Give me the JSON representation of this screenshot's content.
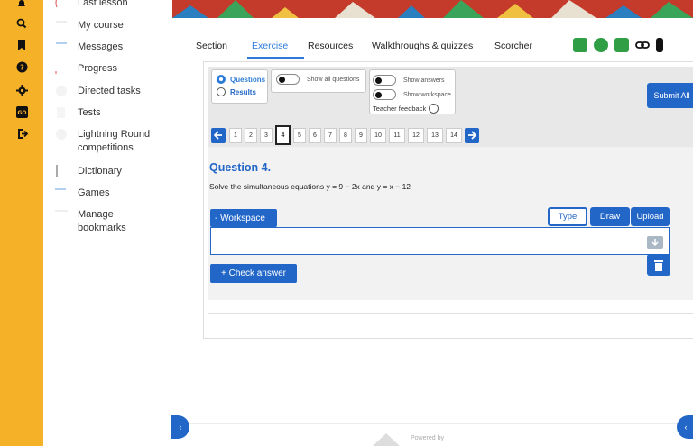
{
  "rail": {
    "icons": [
      "bell-icon",
      "search-icon",
      "bookmark-icon",
      "help-icon",
      "settings-icon",
      "go-icon",
      "logout-icon"
    ],
    "go_label": "GO",
    "color": "#f5b228"
  },
  "sidebar": {
    "items": [
      {
        "label": "Last lesson",
        "icon": "last-lesson-icon"
      },
      {
        "label": "My course",
        "icon": "course-icon"
      },
      {
        "label": "Messages",
        "icon": "messages-icon"
      },
      {
        "label": "Progress",
        "icon": "progress-icon"
      },
      {
        "label": "Directed tasks",
        "icon": "directed-tasks-icon"
      },
      {
        "label": "Tests",
        "icon": "tests-icon"
      },
      {
        "label": "Lightning Round competitions",
        "icon": "lightning-icon"
      },
      {
        "label": "Dictionary",
        "icon": "dictionary-icon"
      },
      {
        "label": "Games",
        "icon": "games-icon"
      },
      {
        "label": "Manage bookmarks",
        "icon": "bookmarks-icon"
      }
    ]
  },
  "tabs": {
    "items": [
      "Section",
      "Exercise",
      "Resources",
      "Walkthroughs & quizzes",
      "Scorcher"
    ],
    "active": "Exercise",
    "tool_icons": [
      "graph-tool-icon",
      "calculator-icon",
      "app-icon",
      "link-icon",
      "bookmark-icon"
    ]
  },
  "controls": {
    "questions_label": "Questions",
    "results_label": "Results",
    "show_all_questions": "Show all questions",
    "show_answers": "Show answers",
    "show_workspace": "Show workspace",
    "teacher_feedback": "Teacher feedback",
    "submit_all": "Submit All"
  },
  "pager": {
    "pages": [
      "1",
      "2",
      "3",
      "4",
      "5",
      "6",
      "7",
      "8",
      "9",
      "10",
      "11",
      "12",
      "13",
      "14"
    ],
    "current": "4"
  },
  "question": {
    "title": "Question 4.",
    "text": "Solve the simultaneous equations y = 9 − 2x and y = x − 12",
    "workspace_label": "- Workspace",
    "mode_type": "Type",
    "mode_draw": "Draw",
    "mode_upload": "Upload",
    "check_answer": "+ Check answer"
  },
  "footer": {
    "powered": "Powered by"
  },
  "colors": {
    "accent": "#2266c8",
    "tab_active": "#2c7bd6"
  }
}
